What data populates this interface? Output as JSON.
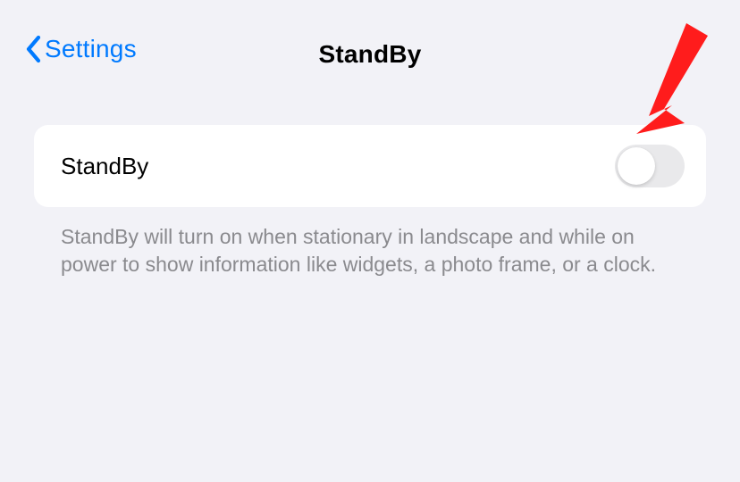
{
  "nav": {
    "back_label": "Settings",
    "title": "StandBy"
  },
  "settings": {
    "standby_row": {
      "label": "StandBy",
      "enabled": false
    },
    "footer": "StandBy will turn on when stationary in landscape and while on power to show information like widgets, a photo frame, or a clock."
  },
  "annotation": {
    "arrow_color": "#ff0000"
  }
}
